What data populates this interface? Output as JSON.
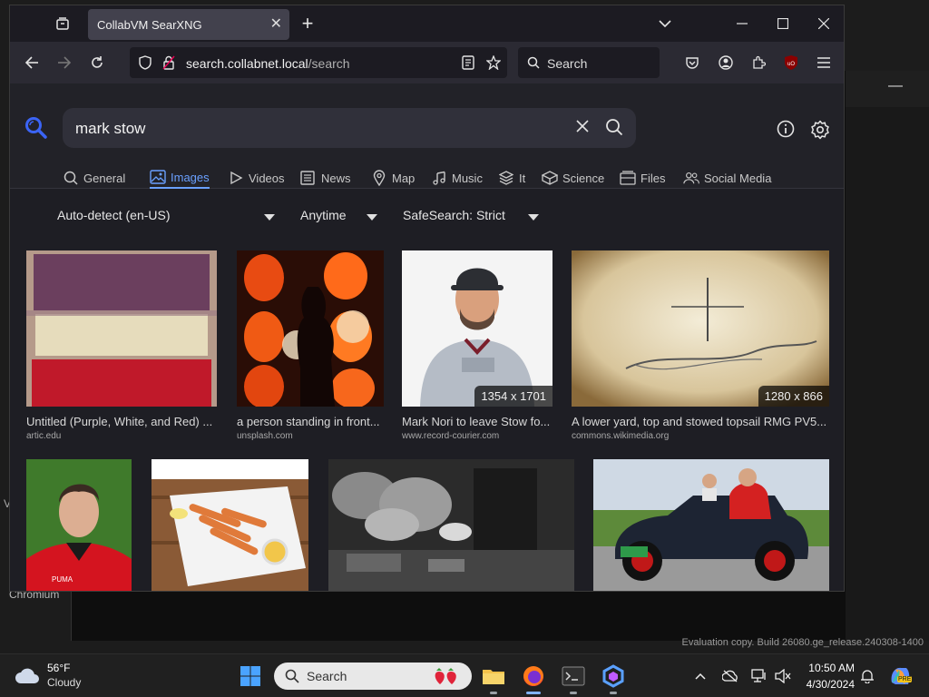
{
  "browser": {
    "tab_title": "CollabVM SearXNG",
    "url_host": "search.collabnet.local",
    "url_path": "/search",
    "search_placeholder": "Search"
  },
  "search": {
    "query": "mark stow",
    "categories": [
      {
        "label": "General",
        "icon": "search-icon"
      },
      {
        "label": "Images",
        "icon": "image-icon",
        "active": true
      },
      {
        "label": "Videos",
        "icon": "play-icon"
      },
      {
        "label": "News",
        "icon": "newspaper-icon"
      },
      {
        "label": "Map",
        "icon": "map-pin-icon"
      },
      {
        "label": "Music",
        "icon": "music-icon"
      },
      {
        "label": "It",
        "icon": "layers-icon"
      },
      {
        "label": "Science",
        "icon": "cube-icon"
      },
      {
        "label": "Files",
        "icon": "files-icon"
      },
      {
        "label": "Social Media",
        "icon": "people-icon"
      }
    ],
    "filters": {
      "language": "Auto-detect (en-US)",
      "time": "Anytime",
      "safesearch": "SafeSearch: Strict"
    }
  },
  "results": [
    {
      "title": "Untitled (Purple, White, and Red) ...",
      "source": "artic.edu",
      "resolution": ""
    },
    {
      "title": "a person standing in front...",
      "source": "unsplash.com",
      "resolution": ""
    },
    {
      "title": "Mark Nori to leave Stow fo...",
      "source": "www.record-courier.com",
      "resolution": "1354 x 1701"
    },
    {
      "title": "A lower yard, top and stowed topsail RMG PV5...",
      "source": "commons.wikimedia.org",
      "resolution": "1280 x 866"
    }
  ],
  "desktop": {
    "chromium_label": "Chromium",
    "letter": "V",
    "watermark": "Evaluation copy. Build 26080.ge_release.240308-1400"
  },
  "taskbar": {
    "weather_temp": "56°F",
    "weather_condition": "Cloudy",
    "search_label": "Search",
    "time": "10:50 AM",
    "date": "4/30/2024",
    "copilot_badge": "PRE"
  },
  "colors": {
    "accent": "#6aa0ff",
    "logo_blue": "#3b64f5"
  }
}
